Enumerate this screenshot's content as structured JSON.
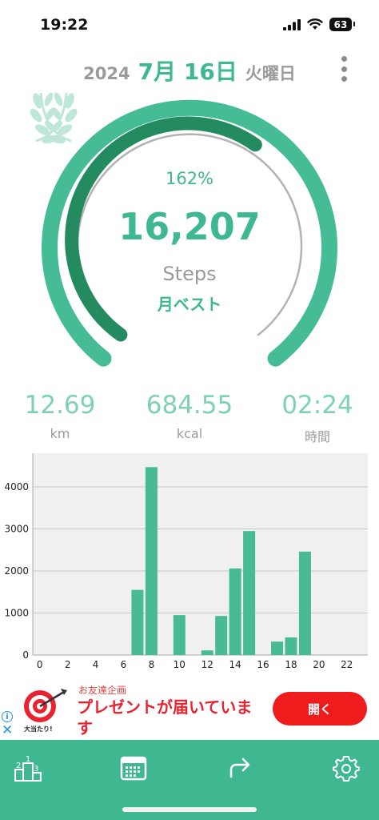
{
  "status_bar": {
    "time": "19:22",
    "battery": "63"
  },
  "header": {
    "year": "2024",
    "date": "7月 16日",
    "weekday": "火曜日"
  },
  "gauge": {
    "percent_text": "162%",
    "steps": "16,207",
    "unit": "Steps",
    "badge": "月ベスト",
    "progress_fraction": 1.0,
    "inner_progress_fraction": 0.62
  },
  "stats": [
    {
      "value": "12.69",
      "label": "km"
    },
    {
      "value": "684.55",
      "label": "kcal"
    },
    {
      "value": "02:24",
      "label": "時間"
    }
  ],
  "colors": {
    "accent": "#3db891",
    "accent_dark": "#238b5f",
    "bar": "#49bb94",
    "tab_bar": "#3fb892"
  },
  "chart_data": {
    "type": "bar",
    "x": [
      0,
      1,
      2,
      3,
      4,
      5,
      6,
      7,
      8,
      9,
      10,
      11,
      12,
      13,
      14,
      15,
      16,
      17,
      18,
      19,
      20,
      21,
      22,
      23
    ],
    "values": [
      0,
      0,
      0,
      0,
      0,
      0,
      0,
      1550,
      4470,
      0,
      950,
      0,
      110,
      930,
      2060,
      2950,
      0,
      320,
      420,
      2460,
      0,
      0,
      0,
      0
    ],
    "xticks": [
      "0",
      "2",
      "4",
      "6",
      "8",
      "10",
      "12",
      "14",
      "16",
      "18",
      "20",
      "22"
    ],
    "yticks": [
      "0",
      "1000",
      "2000",
      "3000",
      "4000"
    ],
    "ylim": [
      0,
      4800
    ],
    "grid": true
  },
  "ad": {
    "caption": "お友達企画",
    "headline": "プレゼントが届いています",
    "button": "開く",
    "info": "i",
    "close": "✕",
    "logo_text": "大当たり!"
  },
  "tabs": [
    {
      "icon": "ranking-icon"
    },
    {
      "icon": "calendar-icon"
    },
    {
      "icon": "share-icon"
    },
    {
      "icon": "gear-icon"
    }
  ]
}
